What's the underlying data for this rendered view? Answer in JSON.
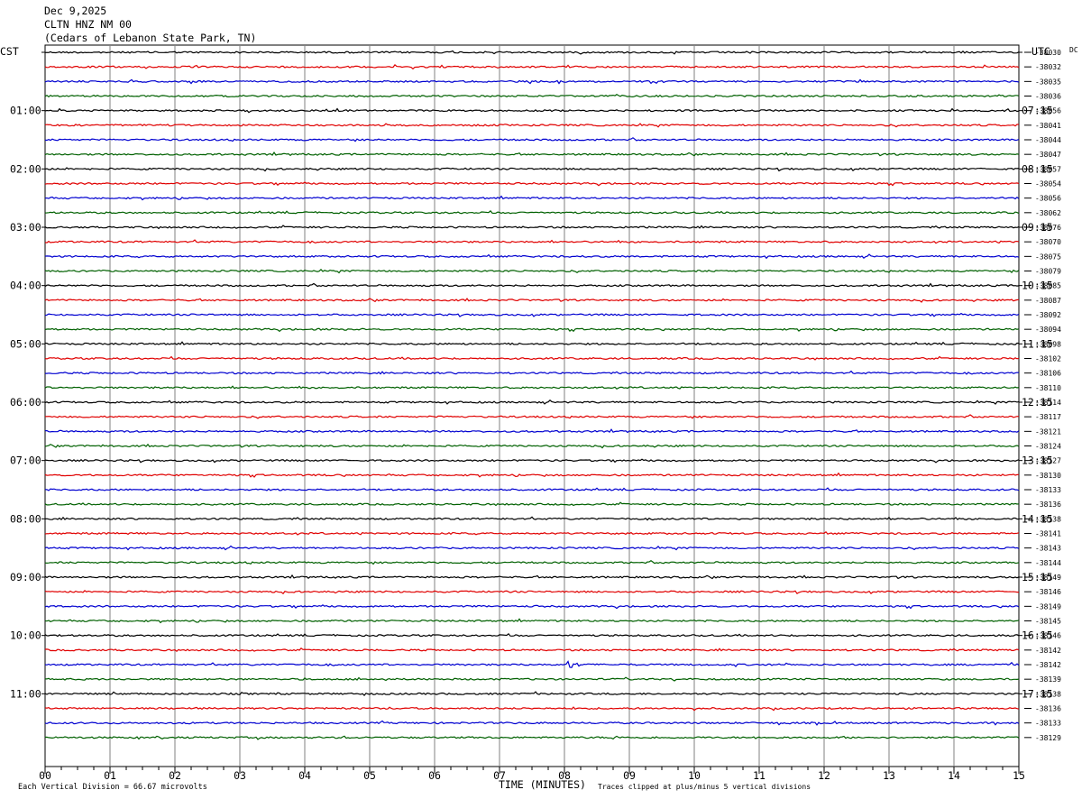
{
  "header": {
    "date": "Dec 9,2025",
    "station": "CLTN HNZ NM 00",
    "location": "(Cedars of Lebanon State Park, TN)"
  },
  "left_axis_label": "CST",
  "right_axis_label": "UTC",
  "right_corner_label": "DC",
  "footer": {
    "scale_note": "Each Vertical Division =   66.67 microvolts",
    "xlabel": "TIME (MINUTES)",
    "clip_note": "Traces clipped at plus/minus 5 vertical divisions"
  },
  "chart_data": {
    "type": "line",
    "title": "CLTN HNZ NM 00",
    "xlabel": "TIME (MINUTES)",
    "xlim": [
      0,
      15
    ],
    "x_ticks": [
      "00",
      "01",
      "02",
      "03",
      "04",
      "05",
      "06",
      "07",
      "08",
      "09",
      "10",
      "11",
      "12",
      "13",
      "14",
      "15"
    ],
    "grid": true,
    "trace_colors": [
      "#000000",
      "#e00000",
      "#0000d0",
      "#006000"
    ],
    "left_hour_labels": [
      "01:00",
      "02:00",
      "03:00",
      "04:00",
      "05:00",
      "06:00",
      "07:00",
      "08:00",
      "09:00",
      "10:00",
      "11:00"
    ],
    "right_hour_labels": [
      "07:15",
      "08:15",
      "09:15",
      "10:15",
      "11:15",
      "12:15",
      "13:15",
      "14:15",
      "15:15",
      "16:15",
      "17:15"
    ],
    "dc_offsets": [
      "-38030",
      "-38032",
      "-38035",
      "-38036",
      "-38056",
      "-38041",
      "-38044",
      "-38047",
      "-38057",
      "-38054",
      "-38056",
      "-38062",
      "-38076",
      "-38070",
      "-38075",
      "-38079",
      "-38085",
      "-38087",
      "-38092",
      "-38094",
      "-38098",
      "-38102",
      "-38106",
      "-38110",
      "-38114",
      "-38117",
      "-38121",
      "-38124",
      "-38127",
      "-38130",
      "-38133",
      "-38136",
      "-38138",
      "-38141",
      "-38143",
      "-38144",
      "-38149",
      "-38146",
      "-38149",
      "-38145",
      "-38146",
      "-38142",
      "-38142",
      "-38139",
      "-38138",
      "-38136",
      "-38133",
      "-38129"
    ],
    "events": [
      {
        "trace": 42,
        "minute": 8.05,
        "amplitude_divisions": 2.5
      }
    ]
  }
}
